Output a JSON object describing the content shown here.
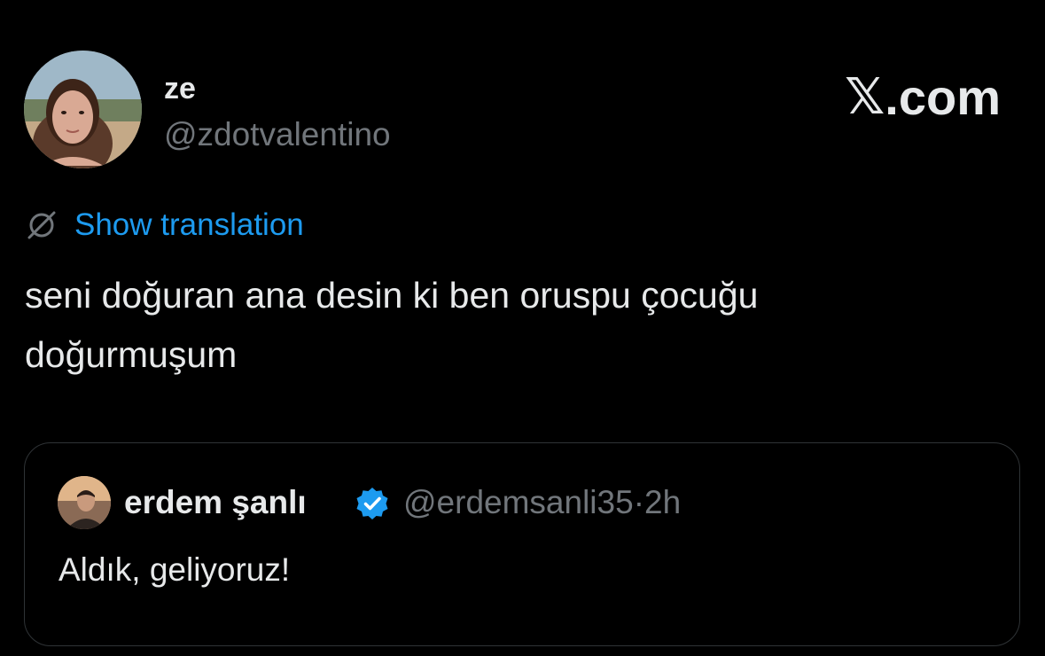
{
  "author": {
    "display_name": "ze",
    "handle": "@zdotvalentino",
    "avatar": "profile-photo"
  },
  "brand": {
    "x_glyph": "𝕏",
    "suffix": ".com"
  },
  "translate": {
    "icon": "globe-slash-icon",
    "label": "Show translation"
  },
  "tweet": {
    "text": "seni doğuran ana desin ki ben oruspu çocuğu\ndoğurmuşum"
  },
  "quoted_tweet": {
    "display_name": "erdem şanlı",
    "verified": true,
    "verified_icon": "verified-badge-icon",
    "handle": "@erdemsanli35",
    "separator": "·",
    "time": "2h",
    "text": "Aldık, geliyoruz!"
  },
  "colors": {
    "background": "#000000",
    "primary_text": "#e7e9ea",
    "secondary_text": "#71767b",
    "link": "#1d9bf0",
    "border": "#2f3336",
    "verified": "#1d9bf0"
  }
}
